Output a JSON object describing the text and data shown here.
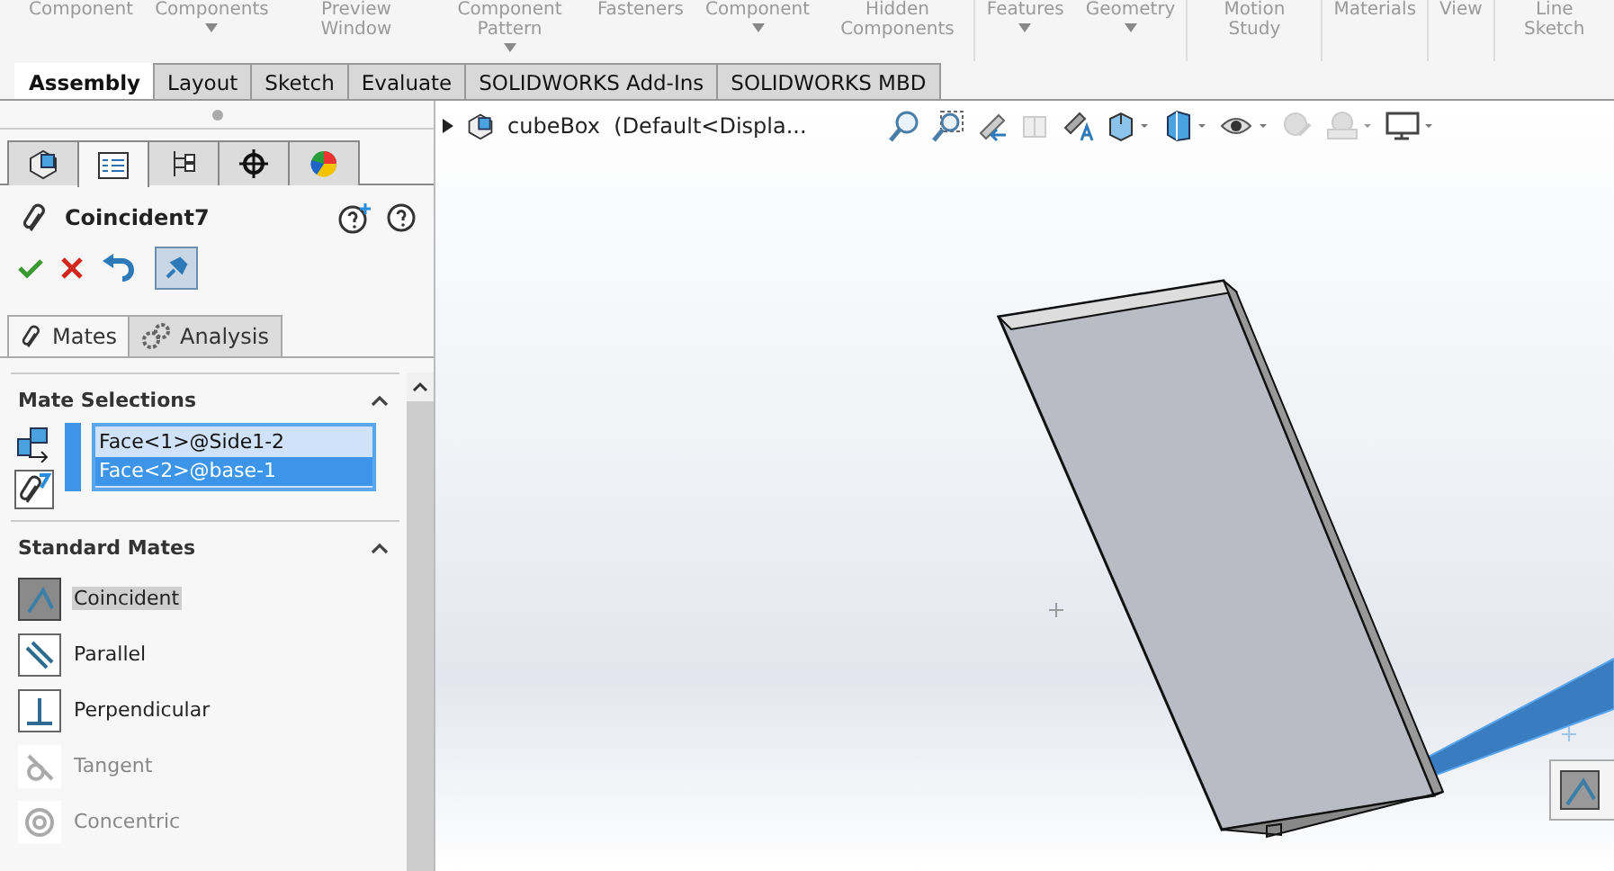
{
  "ribbon": [
    {
      "label": "Component",
      "dropdown": false
    },
    {
      "label": "Components",
      "dropdown": true
    },
    {
      "label": "Preview Window",
      "dropdown": false
    },
    {
      "label": "Component Pattern",
      "dropdown": true
    },
    {
      "label": "Fasteners",
      "dropdown": false
    },
    {
      "label": "Component",
      "dropdown": true
    },
    {
      "label": "Hidden Components",
      "dropdown": false
    },
    {
      "label": "Features",
      "dropdown": true
    },
    {
      "label": "Geometry",
      "dropdown": true
    },
    {
      "label": "Motion Study",
      "dropdown": false
    },
    {
      "label": "Materials",
      "dropdown": false
    },
    {
      "label": "View",
      "dropdown": false
    },
    {
      "label": "Line Sketch",
      "dropdown": false
    }
  ],
  "tabs": [
    {
      "label": "Assembly",
      "selected": true
    },
    {
      "label": "Layout",
      "selected": false
    },
    {
      "label": "Sketch",
      "selected": false
    },
    {
      "label": "Evaluate",
      "selected": false
    },
    {
      "label": "SOLIDWORKS Add-Ins",
      "selected": false
    },
    {
      "label": "SOLIDWORKS MBD",
      "selected": false
    }
  ],
  "panel_tabs": [
    {
      "kind": "parts",
      "selected": false
    },
    {
      "kind": "properties",
      "selected": true
    },
    {
      "kind": "config",
      "selected": false
    },
    {
      "kind": "target",
      "selected": false
    },
    {
      "kind": "appearance",
      "selected": false
    }
  ],
  "feature": {
    "title": "Coincident7",
    "pinned": true
  },
  "subtabs": [
    {
      "label": "Mates",
      "selected": true
    },
    {
      "label": "Analysis",
      "selected": false
    }
  ],
  "mate_selections": {
    "title": "Mate Selections",
    "items": [
      {
        "text": "Face<1>@Side1-2",
        "selected": false
      },
      {
        "text": "Face<2>@base-1",
        "selected": true
      }
    ]
  },
  "standard_mates": {
    "title": "Standard Mates",
    "items": [
      {
        "kind": "coincident",
        "label": "Coincident",
        "selected": true,
        "disabled": false
      },
      {
        "kind": "parallel",
        "label": "Parallel",
        "selected": false,
        "disabled": false
      },
      {
        "kind": "perpendicular",
        "label": "Perpendicular",
        "selected": false,
        "disabled": false
      },
      {
        "kind": "tangent",
        "label": "Tangent",
        "selected": false,
        "disabled": true
      },
      {
        "kind": "concentric",
        "label": "Concentric",
        "selected": false,
        "disabled": true
      }
    ]
  },
  "tree": {
    "label": "cubeBox  (Default<Displa..."
  }
}
